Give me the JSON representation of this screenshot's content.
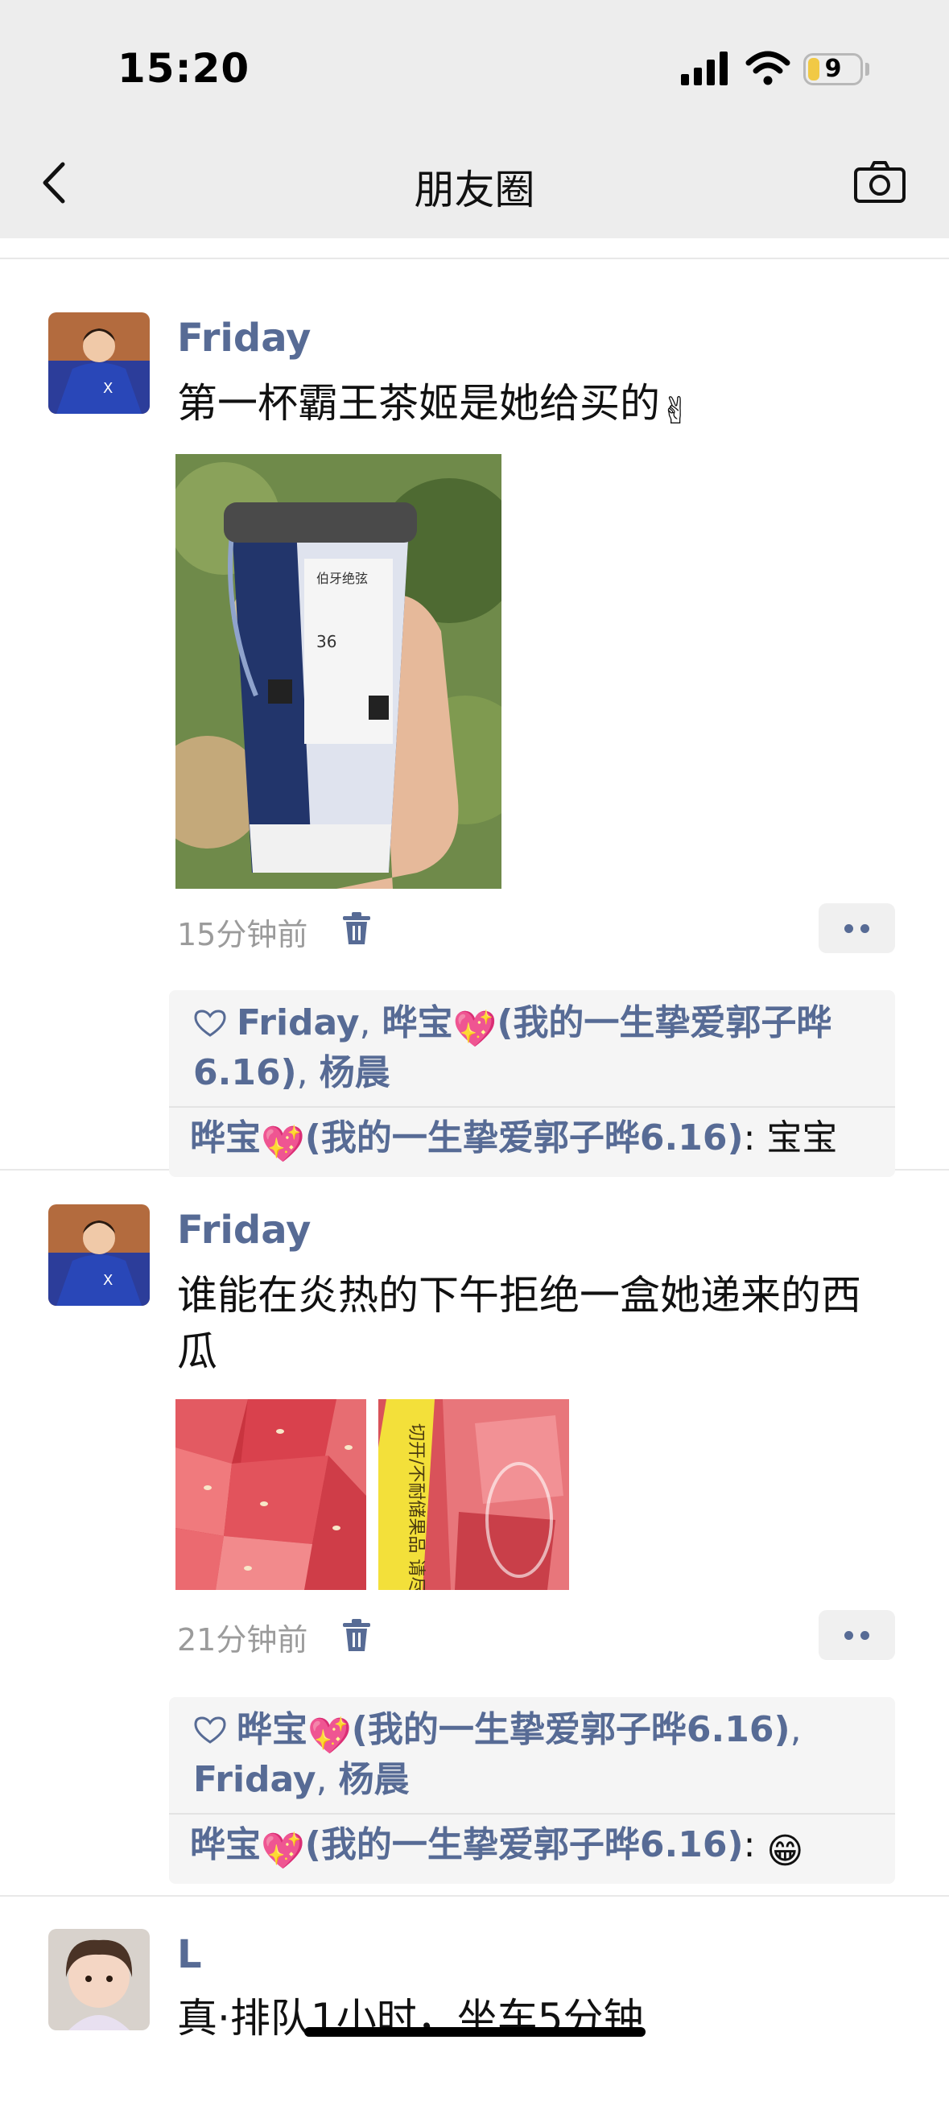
{
  "status_bar": {
    "time": "15:20",
    "battery": "9"
  },
  "nav": {
    "title": "朋友圈"
  },
  "posts": [
    {
      "author": "Friday",
      "text": "第一杯霸王茶姬是她给买的",
      "text_emoji": "✌",
      "time_ago": "15分钟前",
      "likes": [
        "Friday",
        "晔宝",
        "(我的一生挚爱郭子晔6.16)",
        "杨晨"
      ],
      "comment": {
        "who": "晔宝",
        "who_suffix": "(我的一生挚爱郭子晔6.16)",
        "text": "宝宝"
      }
    },
    {
      "author": "Friday",
      "text": "谁能在炎热的下午拒绝一盒她递来的西瓜",
      "time_ago": "21分钟前",
      "likes": [
        "晔宝",
        "(我的一生挚爱郭子晔6.16)",
        "Friday",
        "杨晨"
      ],
      "comment": {
        "who": "晔宝",
        "who_suffix": "(我的一生挚爱郭子晔6.16)",
        "text": ""
      },
      "photo2_label": "切开/不耐储果品 请尽快食用哟"
    },
    {
      "author": "L",
      "text": "真·排队1小时，坐车5分钟"
    }
  ],
  "colors": {
    "link": "#576b95",
    "header_bg": "#ededed"
  },
  "icons": [
    "back-chevron-icon",
    "camera-icon",
    "trash-icon",
    "heart-outline-icon",
    "sparkling-heart-emoji",
    "grinning-emoji"
  ]
}
